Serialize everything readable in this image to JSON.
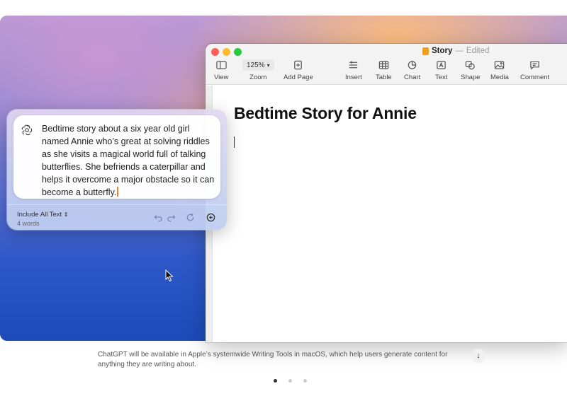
{
  "window": {
    "doc_name": "Story",
    "doc_separator": "—",
    "doc_status": "Edited"
  },
  "toolbar": {
    "view": "View",
    "zoom_value": "125%",
    "zoom": "Zoom",
    "add_page": "Add Page",
    "insert": "Insert",
    "table": "Table",
    "chart": "Chart",
    "text": "Text",
    "shape": "Shape",
    "media": "Media",
    "comment": "Comment"
  },
  "document": {
    "heading": "Bedtime Story for Annie"
  },
  "writing_tools": {
    "prompt": "Bedtime story about a six year old girl named Annie who’s great at solving riddles as she visits a magical world full of talking butterflies. She befriends a caterpillar and helps it overcome a major obstacle so it can become a butterfly.",
    "include_option": "Include All Text",
    "word_count": "4 words"
  },
  "caption": {
    "text": "ChatGPT will be available in Apple’s systemwide Writing Tools in macOS, which help users generate content for anything they are writing about."
  },
  "colors": {
    "accent_cursor": "#e08a2c",
    "close": "#fe5f57",
    "minimize": "#febc2e",
    "zoom": "#28c840"
  }
}
